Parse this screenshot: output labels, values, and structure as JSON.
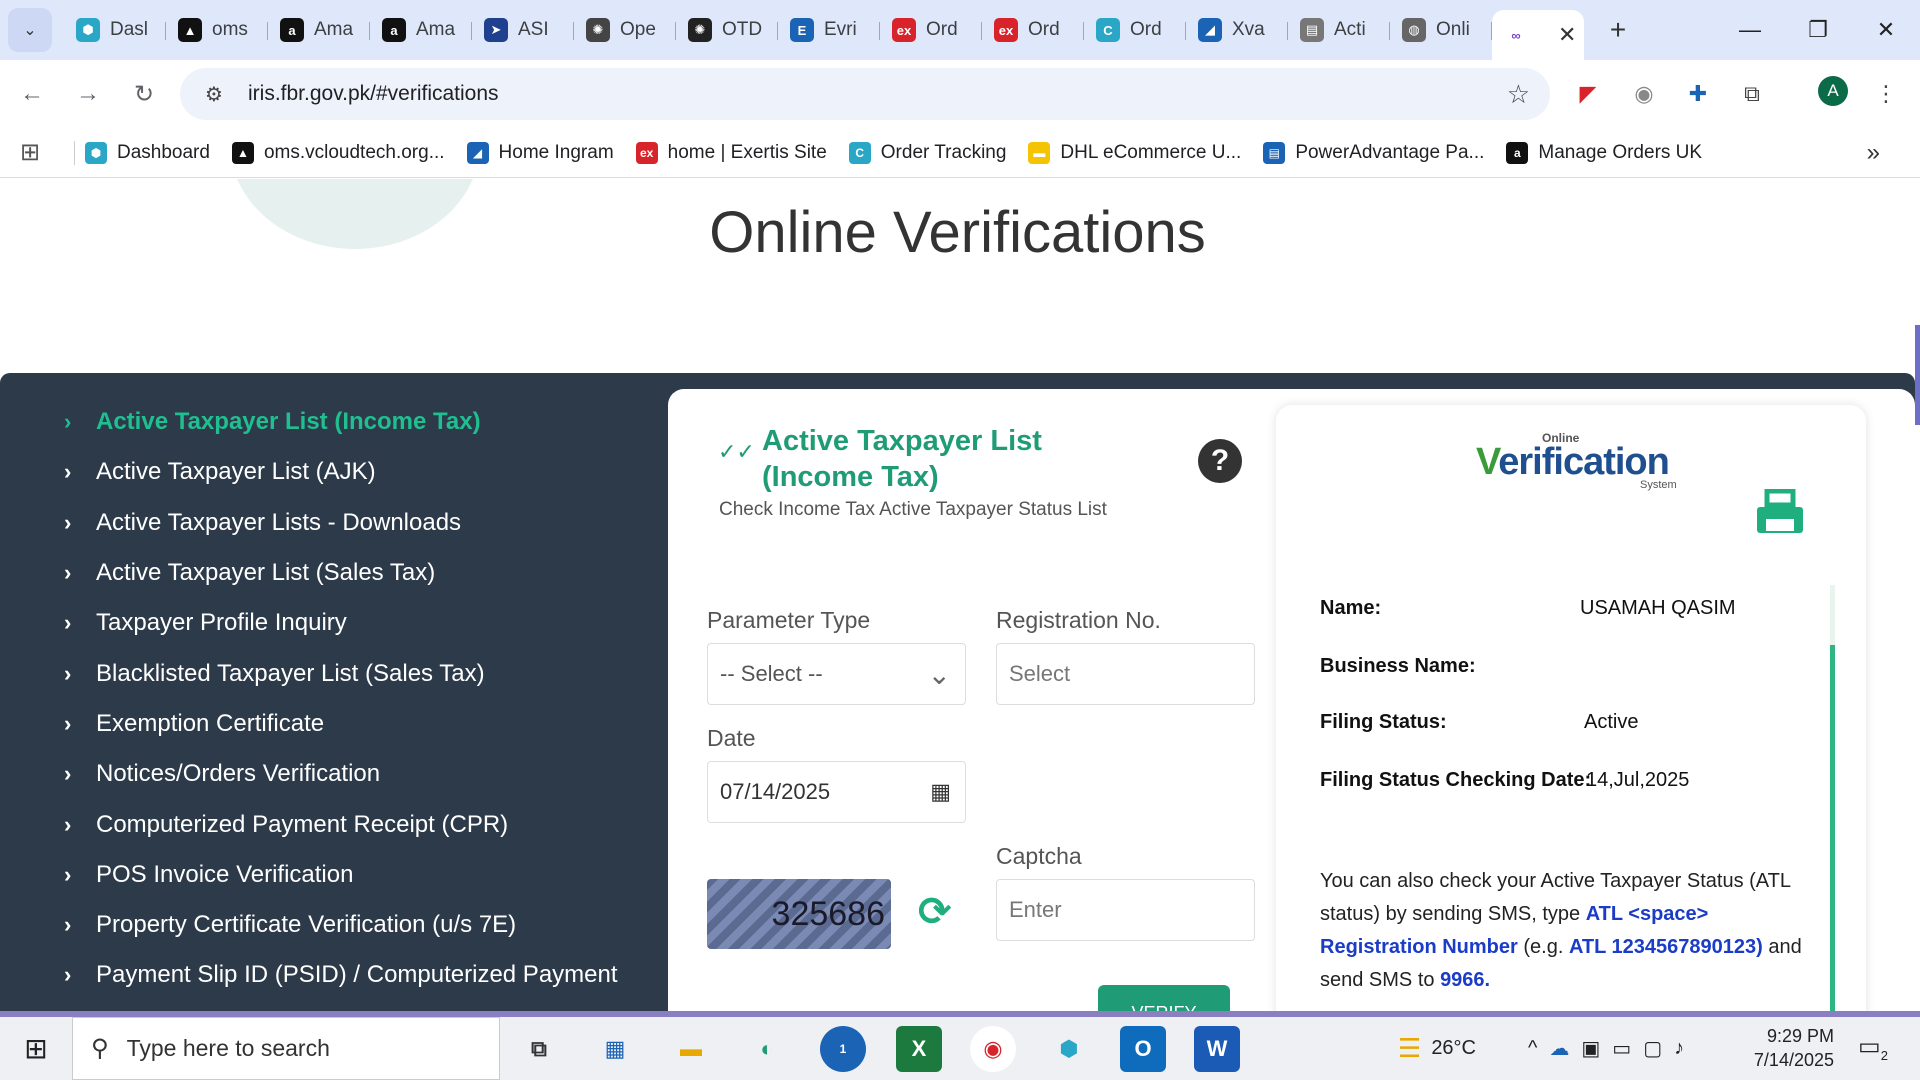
{
  "browser": {
    "tabs": [
      {
        "label": "Dasl",
        "icon": "hexagon-icon",
        "color": "#2aa6c7"
      },
      {
        "label": "oms",
        "icon": "triangle-icon",
        "color": "#111111"
      },
      {
        "label": "Ama",
        "icon": "amazon-icon",
        "color": "#111111"
      },
      {
        "label": "Ama",
        "icon": "amazon-icon",
        "color": "#111111"
      },
      {
        "label": "ASI",
        "icon": "arrow-icon",
        "color": "#1f3f8f"
      },
      {
        "label": "Ope",
        "icon": "openai-icon",
        "color": "#444444"
      },
      {
        "label": "OTD",
        "icon": "openai-icon",
        "color": "#222222"
      },
      {
        "label": "Evri",
        "icon": "evri-icon",
        "color": "#1b63b5"
      },
      {
        "label": "Ord",
        "icon": "exertis-icon",
        "color": "#d8232a"
      },
      {
        "label": "Ord",
        "icon": "exertis-icon",
        "color": "#d8232a"
      },
      {
        "label": "Ord",
        "icon": "order-tracking-icon",
        "color": "#2aa6c7"
      },
      {
        "label": "Xva",
        "icon": "ingram-icon",
        "color": "#1b63b5"
      },
      {
        "label": "Acti",
        "icon": "document-icon",
        "color": "#777777"
      },
      {
        "label": "Onli",
        "icon": "globe-icon",
        "color": "#666666"
      }
    ],
    "url": "iris.fbr.gov.pk/#verifications",
    "profile_initial": "A",
    "bookmarks": [
      {
        "label": "Dashboard",
        "icon": "hexagon-icon",
        "color": "#2aa6c7"
      },
      {
        "label": "oms.vcloudtech.org...",
        "icon": "triangle-icon",
        "color": "#111111"
      },
      {
        "label": "Home Ingram",
        "icon": "ingram-icon",
        "color": "#1b63b5"
      },
      {
        "label": "home | Exertis Site",
        "icon": "exertis-icon",
        "color": "#d8232a"
      },
      {
        "label": "Order Tracking",
        "icon": "order-tracking-icon",
        "color": "#2aa6c7"
      },
      {
        "label": "DHL eCommerce U...",
        "icon": "dhl-icon",
        "color": "#f5c400"
      },
      {
        "label": "PowerAdvantage Pa...",
        "icon": "document-icon",
        "color": "#1b63b5"
      },
      {
        "label": "Manage Orders UK",
        "icon": "amazon-icon",
        "color": "#111111"
      }
    ]
  },
  "page": {
    "title": "Online Verifications",
    "menu": [
      "Active Taxpayer List (Income Tax)",
      "Active Taxpayer List (AJK)",
      "Active Taxpayer Lists - Downloads",
      "Active Taxpayer List (Sales Tax)",
      "Taxpayer Profile Inquiry",
      "Blacklisted Taxpayer List (Sales Tax)",
      "Exemption Certificate",
      "Notices/Orders Verification",
      "Computerized Payment Receipt (CPR)",
      "POS Invoice Verification",
      "Property Certificate Verification (u/s 7E)",
      "Payment Slip ID (PSID) / Computerized Payment"
    ],
    "form": {
      "title": "Active Taxpayer List (Income Tax)",
      "subtitle": "Check Income Tax Active Taxpayer Status List",
      "parameter_type_label": "Parameter Type",
      "parameter_type_value": "-- Select --",
      "registration_label": "Registration No.",
      "registration_placeholder": "Select",
      "date_label": "Date",
      "date_value": "07/14/2025",
      "captcha_label": "Captcha",
      "captcha_code": "325686",
      "captcha_placeholder": "Enter",
      "verify_label": "VERIFY"
    },
    "result": {
      "logo_online": "Online",
      "logo_main_v": "V",
      "logo_main_rest": "erification",
      "logo_system": "System",
      "name_label": "Name:",
      "name_value": "USAMAH QASIM",
      "business_label": "Business Name:",
      "business_value": "",
      "filing_label": "Filing Status:",
      "filing_value": "Active",
      "checking_label": "Filing Status Checking Date:",
      "checking_value": "14,Jul,2025",
      "sms_text_1": "You can also check your Active Taxpayer Status (ATL status) by sending SMS, type ",
      "sms_bold_1": "ATL <space> Registration Number",
      "sms_text_2": " (e.g. ",
      "sms_bold_2": "ATL 1234567890123)",
      "sms_text_3": " and send SMS to ",
      "sms_bold_3": "9966."
    }
  },
  "taskbar": {
    "search_placeholder": "Type here to search",
    "weather": "26°C",
    "time": "9:29 PM",
    "date": "7/14/2025",
    "notification_count": "2",
    "zoom_badge": "1"
  },
  "colors": {
    "accent_green": "#1f9c76",
    "panel_dark": "#2d3a4a",
    "link_blue": "#1a3cc7"
  }
}
